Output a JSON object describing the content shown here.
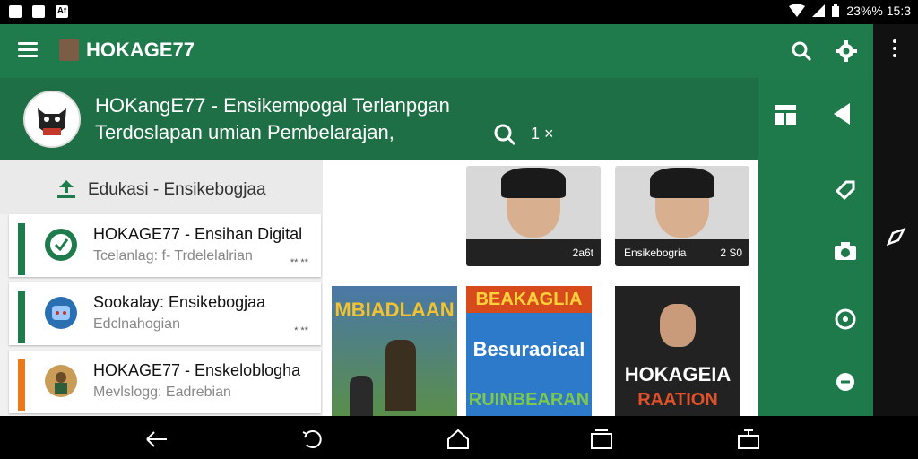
{
  "status_bar": {
    "left_icons": [
      "image-icon",
      "message-icon",
      "text-icon"
    ],
    "left_labels": [
      "",
      "",
      "At"
    ],
    "right_text": "23%% 15:3",
    "icons": [
      "wifi-icon",
      "signal-icon",
      "battery-icon"
    ]
  },
  "app_bar": {
    "title": "HOKAGE77"
  },
  "header": {
    "line1": "HOKangE77 - Ensikempogal Terlanpgan",
    "line2": "Terdoslapan umian Pembelarajan,",
    "zoom_value": "1 ×"
  },
  "list": {
    "header_label": "Edukasi - Ensikebogjaa",
    "items": [
      {
        "title": "HOKAGE77 - Ensihan Digital",
        "subtitle": "Tcelanlag: f- Trdelelalrian",
        "meta": "** **",
        "bar_color": "#1f7a4c"
      },
      {
        "title": "Sookalay: Ensikebogjaa",
        "subtitle": "Edclnahogian",
        "meta": "* **",
        "bar_color": "#1f7a4c"
      },
      {
        "title": "HOKAGE77 - Enskeloblogha",
        "subtitle": "Mevlslogg: Eadrebian",
        "meta": "* **",
        "bar_color": "#e87a1a"
      }
    ]
  },
  "grid": {
    "photos": [
      {
        "caption": "",
        "count": "2a6t"
      },
      {
        "caption": "Ensikebogria",
        "count": "2 S0"
      }
    ],
    "posters": [
      {
        "top": "MBIADLAAN",
        "bottom": ""
      },
      {
        "top": "BEAKAGLIA",
        "middle": "Besuraoical",
        "bottom": "RUINBEARAN"
      },
      {
        "top": "",
        "middle": "HOKAGEIA",
        "bottom": "RAATION"
      }
    ]
  },
  "rail_icons": [
    "layout-icon",
    "play-left-icon",
    "tag-icon",
    "camera-icon",
    "location-icon",
    "refresh-icon",
    "edit-icon"
  ],
  "colors": {
    "primary": "#1f7a4c",
    "header": "#1e6f45",
    "accent_orange": "#e87a1a"
  }
}
